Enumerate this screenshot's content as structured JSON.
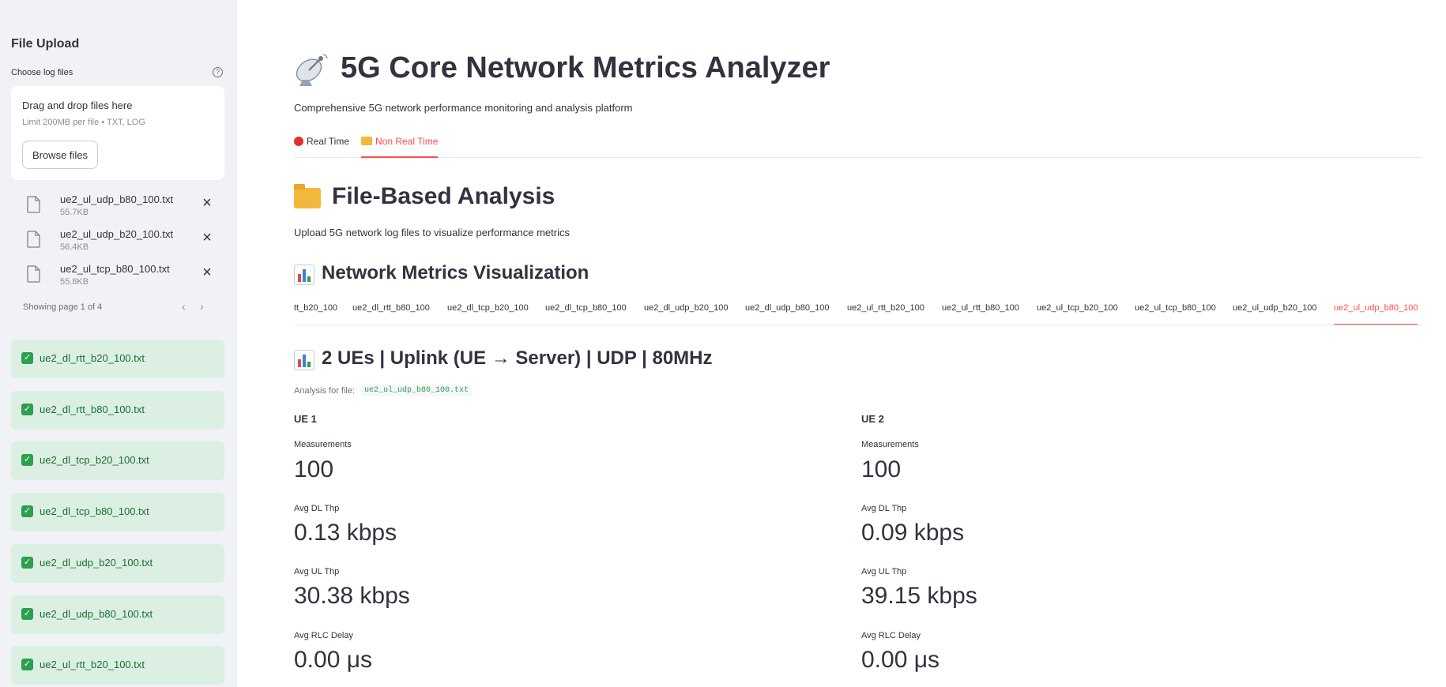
{
  "sidebar": {
    "title": "File Upload",
    "uploader_label": "Choose log files",
    "dropzone_text": "Drag and drop files here",
    "limit_text": "Limit 200MB per file • TXT, LOG",
    "browse_label": "Browse files",
    "uploaded_files": [
      {
        "name": "ue2_ul_udp_b80_100.txt",
        "size": "55.7KB"
      },
      {
        "name": "ue2_ul_udp_b20_100.txt",
        "size": "56.4KB"
      },
      {
        "name": "ue2_ul_tcp_b80_100.txt",
        "size": "55.8KB"
      }
    ],
    "pager_text": "Showing page 1 of 4",
    "success_items": [
      "ue2_dl_rtt_b20_100.txt",
      "ue2_dl_rtt_b80_100.txt",
      "ue2_dl_tcp_b20_100.txt",
      "ue2_dl_tcp_b80_100.txt",
      "ue2_dl_udp_b20_100.txt",
      "ue2_dl_udp_b80_100.txt",
      "ue2_ul_rtt_b20_100.txt"
    ]
  },
  "main": {
    "title": "5G Core Network Metrics Analyzer",
    "subtitle": "Comprehensive 5G network performance monitoring and analysis platform",
    "tabs": [
      {
        "label": "Real Time",
        "active": false
      },
      {
        "label": "Non Real Time",
        "active": true
      }
    ],
    "section_title": "File-Based Analysis",
    "section_desc": "Upload 5G network log files to visualize performance metrics",
    "viz_title": "Network Metrics Visualization",
    "file_tabs": [
      "tt_b20_100",
      "ue2_dl_rtt_b80_100",
      "ue2_dl_tcp_b20_100",
      "ue2_dl_tcp_b80_100",
      "ue2_dl_udp_b20_100",
      "ue2_dl_udp_b80_100",
      "ue2_ul_rtt_b20_100",
      "ue2_ul_rtt_b80_100",
      "ue2_ul_tcp_b20_100",
      "ue2_ul_tcp_b80_100",
      "ue2_ul_udp_b20_100",
      "ue2_ul_udp_b80_100"
    ],
    "active_file_tab": "ue2_ul_udp_b80_100",
    "analysis_title": "2 UEs | Uplink (UE → Server) | UDP | 80MHz",
    "analysis_for_label": "Analysis for file:",
    "analysis_file": "ue2_ul_udp_b80_100.txt",
    "ues": [
      {
        "name": "UE 1",
        "metrics": [
          {
            "label": "Measurements",
            "value": "100"
          },
          {
            "label": "Avg DL Thp",
            "value": "0.13 kbps"
          },
          {
            "label": "Avg UL Thp",
            "value": "30.38 kbps"
          },
          {
            "label": "Avg RLC Delay",
            "value": "0.00 μs"
          }
        ]
      },
      {
        "name": "UE 2",
        "metrics": [
          {
            "label": "Measurements",
            "value": "100"
          },
          {
            "label": "Avg DL Thp",
            "value": "0.09 kbps"
          },
          {
            "label": "Avg UL Thp",
            "value": "39.15 kbps"
          },
          {
            "label": "Avg RLC Delay",
            "value": "0.00 μs"
          }
        ]
      }
    ]
  },
  "colors": {
    "accent": "#ff4b4b",
    "sidebar_bg": "#f0f2f6",
    "success_bg": "#dcefe3",
    "success_text": "#1c6e34"
  }
}
